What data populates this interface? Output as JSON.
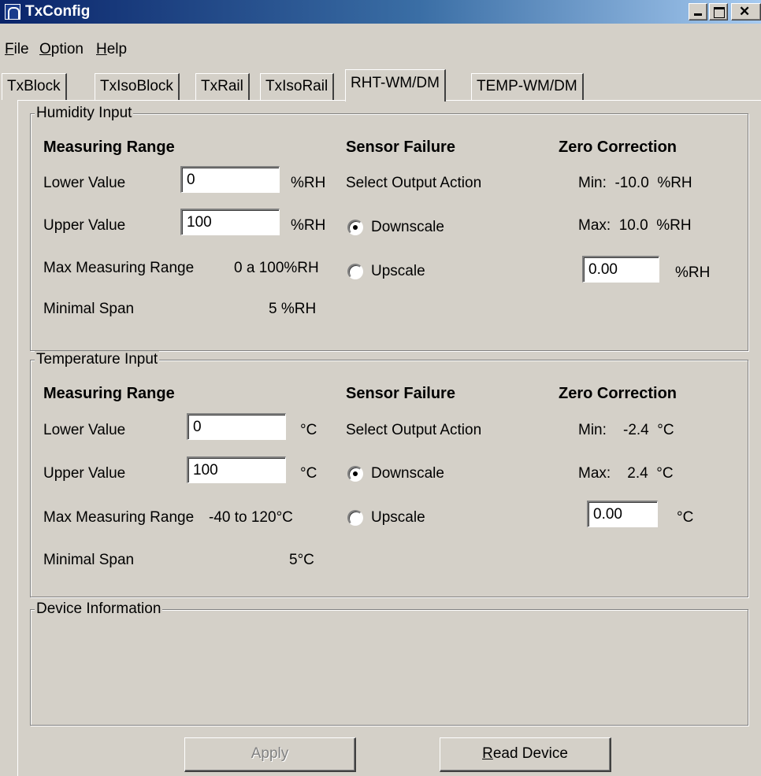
{
  "window": {
    "title": "TxConfig"
  },
  "menu": [
    "File",
    "Option",
    "Help"
  ],
  "tabs": [
    "TxBlock",
    "TxIsoBlock",
    "TxRail",
    "TxIsoRail",
    "RHT-WM/DM",
    "TEMP-WM/DM"
  ],
  "active_tab": "RHT-WM/DM",
  "humidity": {
    "legend": "Humidity Input",
    "measuring_range_heading": "Measuring Range",
    "lower_label": "Lower Value",
    "lower_value": "0",
    "lower_unit": "%RH",
    "upper_label": "Upper Value",
    "upper_value": "100",
    "upper_unit": "%RH",
    "max_range_label": "Max Measuring Range",
    "max_range_value": "0 a 100%RH",
    "min_span_label": "Minimal Span",
    "min_span_value": "5 %RH",
    "sensor_failure_heading": "Sensor Failure",
    "select_action_label": "Select Output Action",
    "downscale_label": "Downscale",
    "upscale_label": "Upscale",
    "selected_action": "Downscale",
    "zero_heading": "Zero Correction",
    "zero_min": "Min:  -10.0  %RH",
    "zero_max": "Max:  10.0  %RH",
    "zero_value": "0.00",
    "zero_unit": "%RH"
  },
  "temperature": {
    "legend": "Temperature Input",
    "measuring_range_heading": "Measuring Range",
    "lower_label": "Lower Value",
    "lower_value": "0",
    "lower_unit": "°C",
    "upper_label": "Upper Value",
    "upper_value": "100",
    "upper_unit": "°C",
    "max_range_label": "Max Measuring Range",
    "max_range_value": "-40 to 120°C",
    "min_span_label": "Minimal Span",
    "min_span_value": "5°C",
    "sensor_failure_heading": "Sensor Failure",
    "select_action_label": "Select Output Action",
    "downscale_label": "Downscale",
    "upscale_label": "Upscale",
    "selected_action": "Downscale",
    "zero_heading": "Zero Correction",
    "zero_min": "Min:    -2.4  °C",
    "zero_max": "Max:    2.4  °C",
    "zero_value": "0.00",
    "zero_unit": "°C"
  },
  "device_info": {
    "legend": "Device Information"
  },
  "buttons": {
    "apply": "Apply",
    "read_device": "Read Device",
    "apply_enabled": false
  }
}
